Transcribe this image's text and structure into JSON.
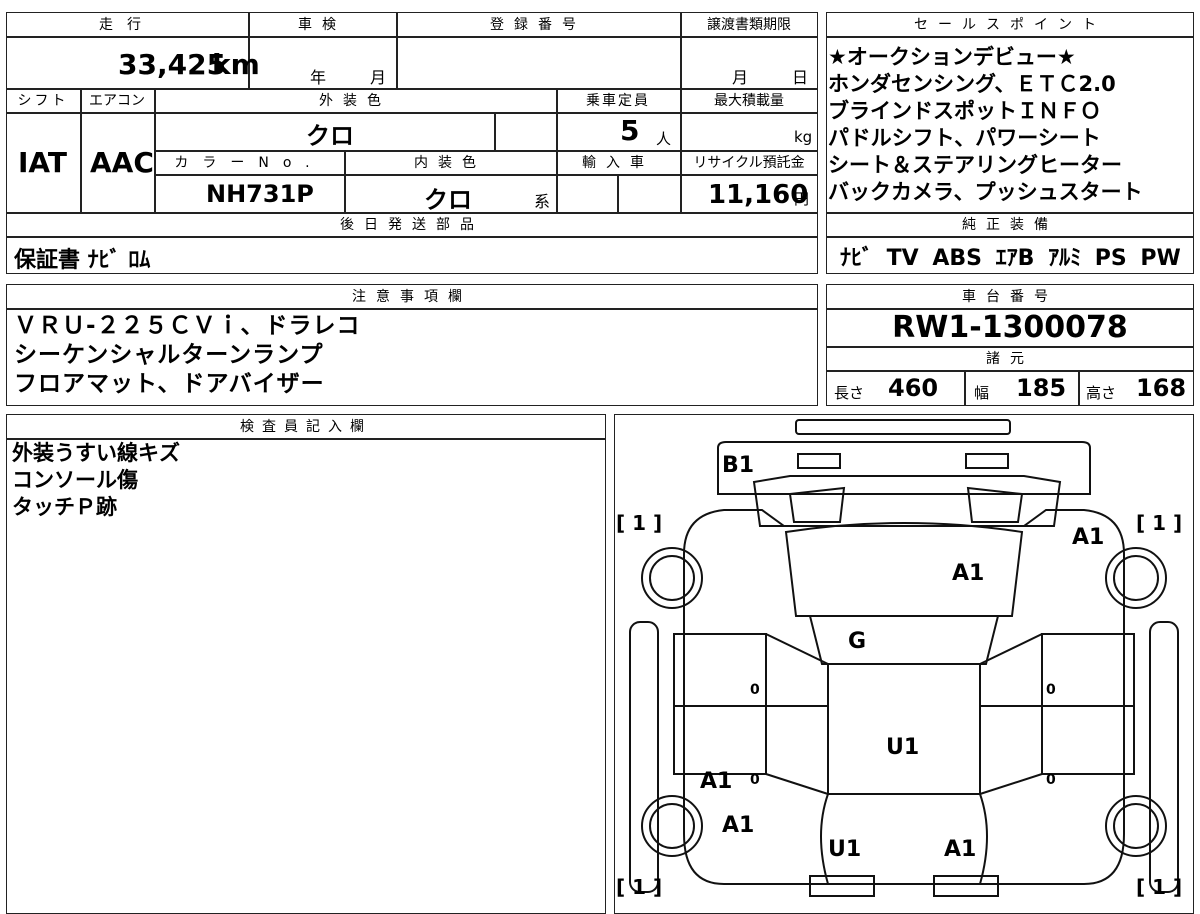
{
  "headers": {
    "mileage": "走行",
    "shaken": "車検",
    "registration": "登録番号",
    "transfer_deadline": "譲渡書類期限",
    "sales_point": "セールスポイント",
    "shift": "シフト",
    "aircon": "エアコン",
    "exterior_color": "外装色",
    "capacity": "乗車定員",
    "max_load": "最大積載量",
    "color_no": "カラーNo.",
    "interior_color": "内装色",
    "import": "輸入車",
    "recycle": "リサイクル預託金",
    "later_parts": "後日発送部品",
    "genuine_equipment": "純正装備",
    "notes": "注意事項欄",
    "chassis_no": "車台番号",
    "specs": "諸元",
    "inspector": "検査員記入欄"
  },
  "values": {
    "mileage": "33,425",
    "mileage_unit": "km",
    "shaken_year": "年",
    "shaken_month": "月",
    "deadline_month": "月",
    "deadline_day": "日",
    "shift": "IAT",
    "aircon": "AAC",
    "exterior_color": "クロ",
    "capacity": "5",
    "capacity_unit": "人",
    "load_unit": "kg",
    "color_no": "NH731P",
    "interior_color": "クロ",
    "interior_suffix": "系",
    "recycle_amount": "11,160",
    "recycle_unit": "円",
    "later_parts": "保証書 ﾅﾋﾞ ﾛﾑ",
    "genuine_equipment": "ﾅﾋﾞ TV ABS ｴｱB ｱﾙﾐ PS PW",
    "chassis_no": "RW1-1300078",
    "length_label": "長さ",
    "length": "460",
    "width_label": "幅",
    "width": "185",
    "height_label": "高さ",
    "height": "168"
  },
  "sales_points": [
    "★オークションデビュー★",
    "ホンダセンシング、ＥＴＣ2.0",
    "ブラインドスポットＩＮＦＯ",
    "パドルシフト、パワーシート",
    "シート＆ステアリングヒーター",
    "バックカメラ、プッシュスタート"
  ],
  "notes": [
    "ＶＲＵ-２２５ＣＶｉ、ドラレコ",
    "シーケンシャルターンランプ",
    "フロアマット、ドアバイザー"
  ],
  "inspector_notes": [
    "外装うすい線キズ",
    "コンソール傷",
    "タッチＰ跡"
  ],
  "diagram": {
    "marks": {
      "rear_bumper": "B1",
      "rear_glass": "A1",
      "roof": "G",
      "hood": "U1",
      "right_rear_fender": "A1",
      "left_front_door": "A1",
      "left_front_fender": "A1",
      "front_bumper_left": "U1",
      "front_bumper_right": "A1"
    },
    "tire_rear_left": "[ 1 ]",
    "tire_rear_right": "[ 1 ]",
    "tire_front_left": "[ 1 ]",
    "tire_front_right": "[ 1 ]",
    "zero": "0"
  }
}
